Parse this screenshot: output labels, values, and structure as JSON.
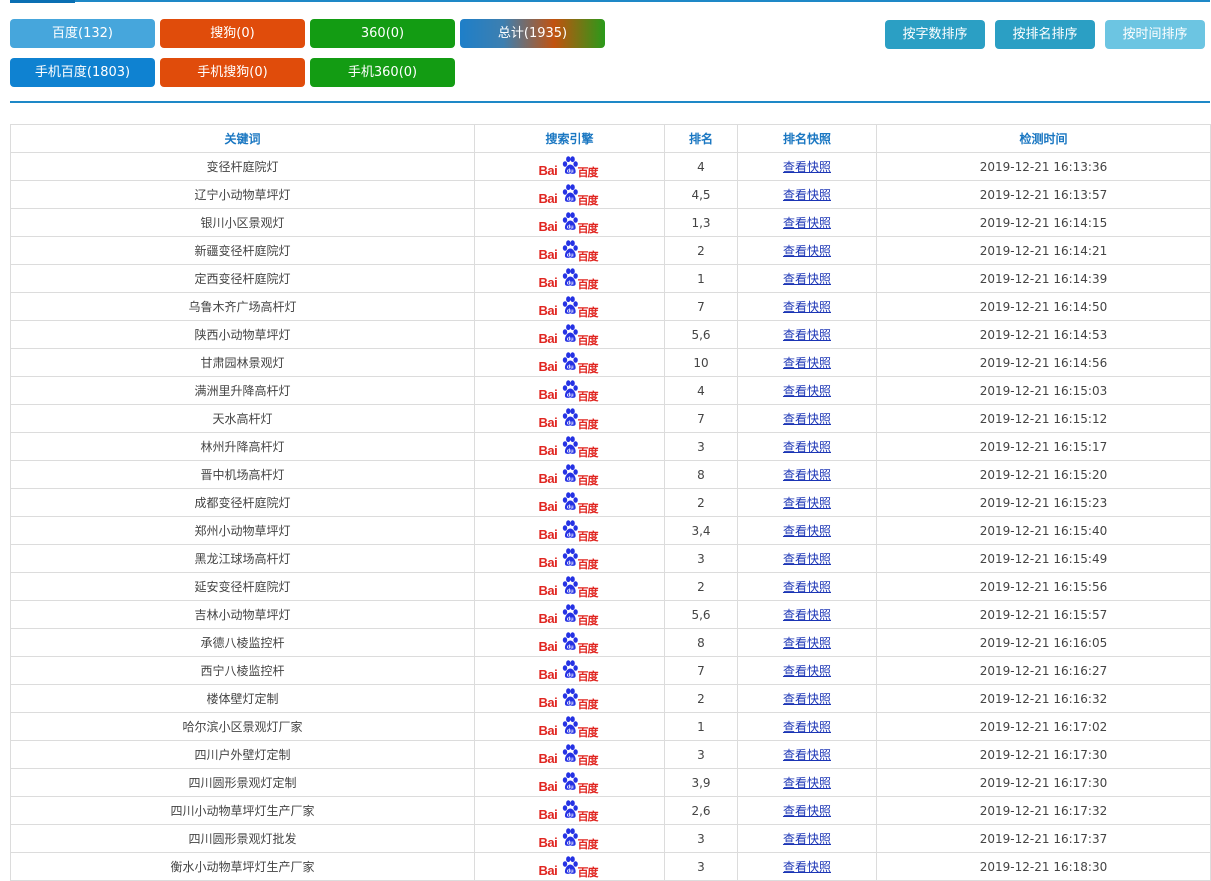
{
  "filters": {
    "baidu": "百度(132)",
    "sogou": "搜狗(0)",
    "s360": "360(0)",
    "total": "总计(1935)",
    "mobile_baidu": "手机百度(1803)",
    "mobile_sogou": "手机搜狗(0)",
    "mobile_360": "手机360(0)"
  },
  "sort": {
    "by_length": "按字数排序",
    "by_rank": "按排名排序",
    "by_time": "按时间排序"
  },
  "table": {
    "headers": [
      "关键词",
      "搜索引擎",
      "排名",
      "排名快照",
      "检测时间"
    ],
    "engine_logo": {
      "bai": "Bai",
      "du": "百度",
      "icon": "baidu-paw-icon"
    },
    "rows": [
      {
        "keyword": "变径杆庭院灯",
        "rank": "4",
        "snapshot": "查看快照",
        "time": "2019-12-21 16:13:36"
      },
      {
        "keyword": "辽宁小动物草坪灯",
        "rank": "4,5",
        "snapshot": "查看快照",
        "time": "2019-12-21 16:13:57"
      },
      {
        "keyword": "银川小区景观灯",
        "rank": "1,3",
        "snapshot": "查看快照",
        "time": "2019-12-21 16:14:15"
      },
      {
        "keyword": "新疆变径杆庭院灯",
        "rank": "2",
        "snapshot": "查看快照",
        "time": "2019-12-21 16:14:21"
      },
      {
        "keyword": "定西变径杆庭院灯",
        "rank": "1",
        "snapshot": "查看快照",
        "time": "2019-12-21 16:14:39"
      },
      {
        "keyword": "乌鲁木齐广场高杆灯",
        "rank": "7",
        "snapshot": "查看快照",
        "time": "2019-12-21 16:14:50"
      },
      {
        "keyword": "陕西小动物草坪灯",
        "rank": "5,6",
        "snapshot": "查看快照",
        "time": "2019-12-21 16:14:53"
      },
      {
        "keyword": "甘肃园林景观灯",
        "rank": "10",
        "snapshot": "查看快照",
        "time": "2019-12-21 16:14:56"
      },
      {
        "keyword": "满洲里升降高杆灯",
        "rank": "4",
        "snapshot": "查看快照",
        "time": "2019-12-21 16:15:03"
      },
      {
        "keyword": "天水高杆灯",
        "rank": "7",
        "snapshot": "查看快照",
        "time": "2019-12-21 16:15:12"
      },
      {
        "keyword": "林州升降高杆灯",
        "rank": "3",
        "snapshot": "查看快照",
        "time": "2019-12-21 16:15:17"
      },
      {
        "keyword": "晋中机场高杆灯",
        "rank": "8",
        "snapshot": "查看快照",
        "time": "2019-12-21 16:15:20"
      },
      {
        "keyword": "成都变径杆庭院灯",
        "rank": "2",
        "snapshot": "查看快照",
        "time": "2019-12-21 16:15:23"
      },
      {
        "keyword": "郑州小动物草坪灯",
        "rank": "3,4",
        "snapshot": "查看快照",
        "time": "2019-12-21 16:15:40"
      },
      {
        "keyword": "黑龙江球场高杆灯",
        "rank": "3",
        "snapshot": "查看快照",
        "time": "2019-12-21 16:15:49"
      },
      {
        "keyword": "延安变径杆庭院灯",
        "rank": "2",
        "snapshot": "查看快照",
        "time": "2019-12-21 16:15:56"
      },
      {
        "keyword": "吉林小动物草坪灯",
        "rank": "5,6",
        "snapshot": "查看快照",
        "time": "2019-12-21 16:15:57"
      },
      {
        "keyword": "承德八棱监控杆",
        "rank": "8",
        "snapshot": "查看快照",
        "time": "2019-12-21 16:16:05"
      },
      {
        "keyword": "西宁八棱监控杆",
        "rank": "7",
        "snapshot": "查看快照",
        "time": "2019-12-21 16:16:27"
      },
      {
        "keyword": "楼体壁灯定制",
        "rank": "2",
        "snapshot": "查看快照",
        "time": "2019-12-21 16:16:32"
      },
      {
        "keyword": "哈尔滨小区景观灯厂家",
        "rank": "1",
        "snapshot": "查看快照",
        "time": "2019-12-21 16:17:02"
      },
      {
        "keyword": "四川户外壁灯定制",
        "rank": "3",
        "snapshot": "查看快照",
        "time": "2019-12-21 16:17:30"
      },
      {
        "keyword": "四川圆形景观灯定制",
        "rank": "3,9",
        "snapshot": "查看快照",
        "time": "2019-12-21 16:17:30"
      },
      {
        "keyword": "四川小动物草坪灯生产厂家",
        "rank": "2,6",
        "snapshot": "查看快照",
        "time": "2019-12-21 16:17:32"
      },
      {
        "keyword": "四川圆形景观灯批发",
        "rank": "3",
        "snapshot": "查看快照",
        "time": "2019-12-21 16:17:37"
      },
      {
        "keyword": "衡水小动物草坪灯生产厂家",
        "rank": "3",
        "snapshot": "查看快照",
        "time": "2019-12-21 16:18:30"
      }
    ]
  },
  "colors": {
    "accent": "#1e88c7",
    "baidu_btn": "#46a6dc",
    "sogou_btn": "#e04c0b",
    "s360_btn": "#139c13",
    "mobile_baidu_btn": "#0f82d1",
    "sort_btn": "#2b9fc4",
    "baidu_red": "#e02520",
    "baidu_blue": "#2532e4"
  }
}
